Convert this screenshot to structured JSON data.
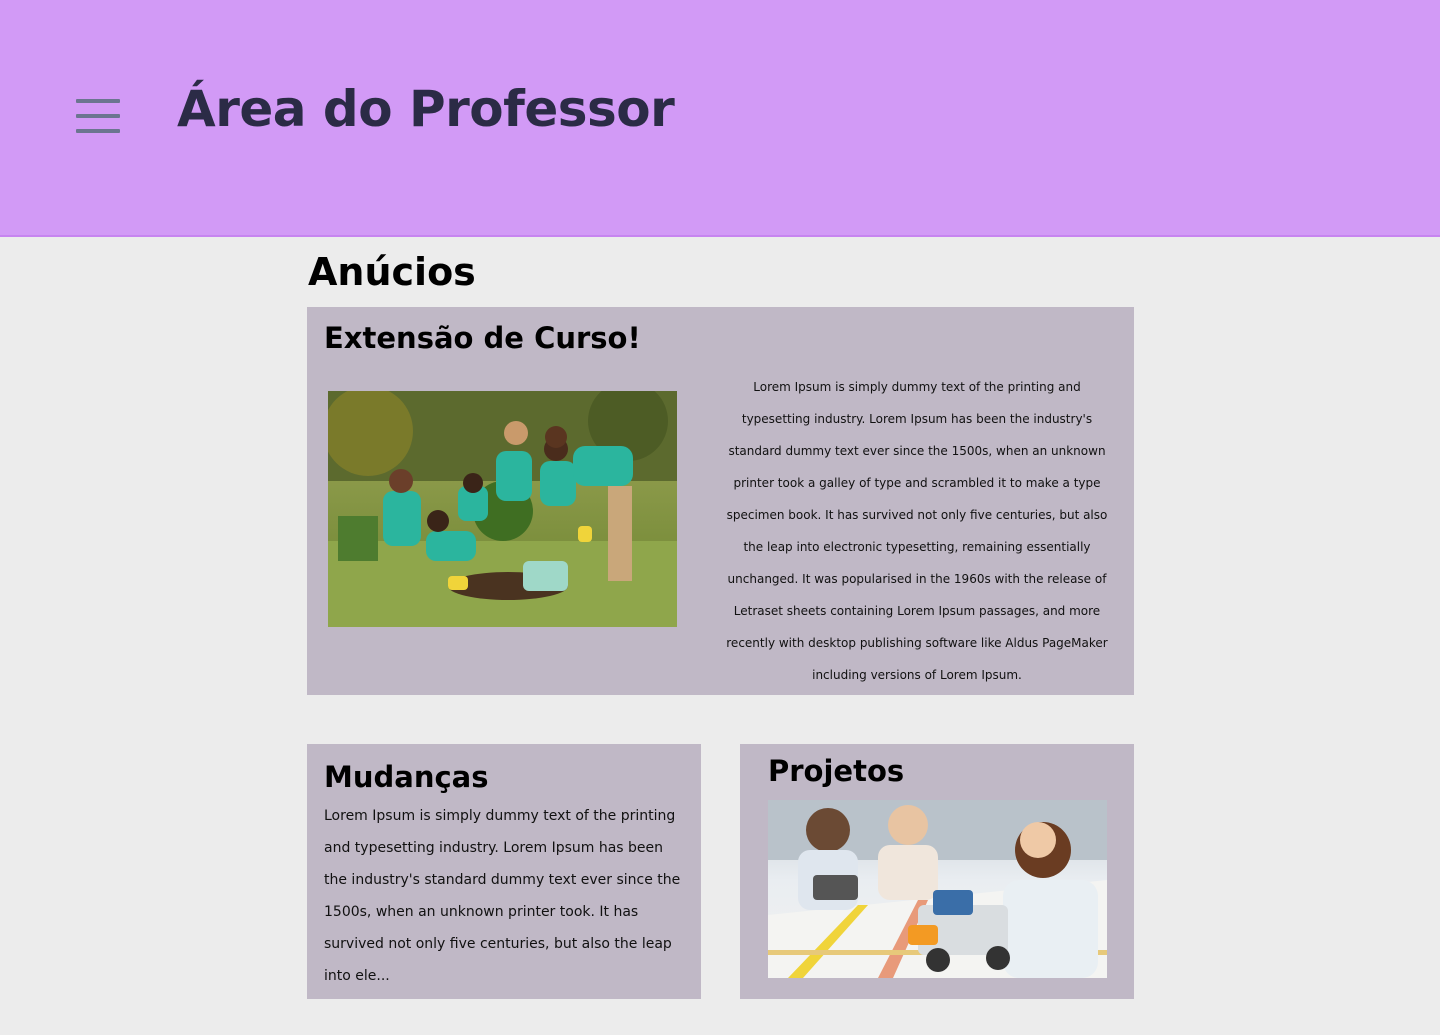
{
  "header": {
    "title": "Área do Professor",
    "menu_icon": "hamburger-menu-icon",
    "background": "#d29af6"
  },
  "section": {
    "title": "Anúcios"
  },
  "featured": {
    "title": "Extensão de Curso!",
    "image": "students-gardening-photo",
    "text": "Lorem Ipsum is simply dummy text of the printing and typesetting industry. Lorem Ipsum has been the industry's standard dummy text ever since the 1500s, when an unknown printer took a galley of type and scrambled it to make a type specimen book. It has survived not only five centuries, but also the leap into electronic typesetting, remaining essentially unchanged. It was popularised in the 1960s with the release of Letraset sheets containing Lorem Ipsum passages, and more recently with desktop publishing software like Aldus PageMaker including versions of Lorem Ipsum."
  },
  "changes": {
    "title": "Mudanças",
    "text": "Lorem Ipsum is simply dummy text of the printing and typesetting industry. Lorem Ipsum has been the industry's standard dummy text ever since the 1500s, when an unknown printer took. It has survived not only five centuries, but also the leap into ele..."
  },
  "projects": {
    "title": "Projetos",
    "image": "students-robotics-photo"
  },
  "colors": {
    "page_background": "#ececec",
    "card_background": "#c0b8c6",
    "title_text": "#2b2b46"
  }
}
